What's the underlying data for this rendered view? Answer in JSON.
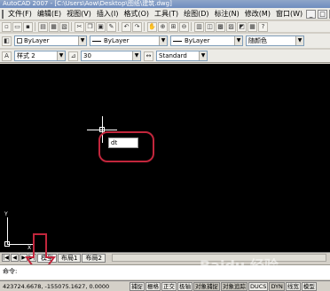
{
  "window": {
    "title": "AutoCAD 2007 - [C:\\Users\\Aow\\Desktop\\图纸\\建筑.dwg]"
  },
  "menu": {
    "items": [
      "文件(F)",
      "编辑(E)",
      "视图(V)",
      "插入(I)",
      "格式(O)",
      "工具(T)",
      "绘图(D)",
      "标注(N)",
      "修改(M)",
      "窗口(W)"
    ],
    "win_buttons": [
      "_",
      "□",
      "×"
    ]
  },
  "properties_toolbar": {
    "layer_combo": "ByLayer",
    "linetype_combo": "ByLayer",
    "lineweight_combo": "ByLayer",
    "color_combo": "随颜色"
  },
  "style_toolbar": {
    "text_style": "样式 2",
    "text_height": "30",
    "dim_style": "Standard"
  },
  "canvas": {
    "dynamic_input_value": "dt",
    "ucs_x_label": "X",
    "ucs_y_label": "Y",
    "annotation_color": "#c2263c"
  },
  "layout_tabs": {
    "nav": [
      "|◀",
      "◀",
      "▶",
      "▶|"
    ],
    "tabs": [
      "模型",
      "布局1",
      "布局2"
    ],
    "active_tab": "模型"
  },
  "command_line": {
    "prompt": "命令:"
  },
  "status_bar": {
    "coordinates": "423724.6678, -155075.1627, 0.0000",
    "toggles": [
      "捕捉",
      "栅格",
      "正交",
      "极轴",
      "对象捕捉",
      "对象追踪",
      "DUCS",
      "DYN",
      "线宽",
      "模型"
    ]
  },
  "watermark": {
    "text": "Baidu 经验"
  }
}
